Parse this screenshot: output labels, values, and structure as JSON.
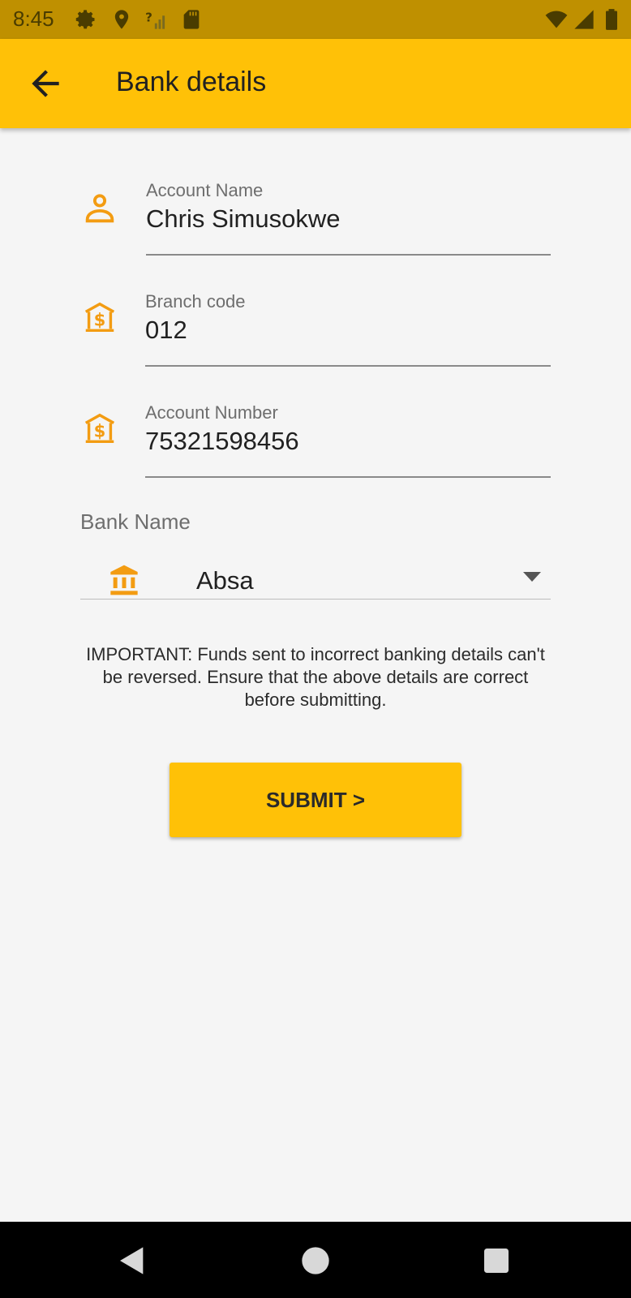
{
  "status_bar": {
    "time": "8:45",
    "icons_left": [
      "gear-icon",
      "location-pin-icon",
      "no-signal-icon",
      "sd-card-icon"
    ],
    "icons_right": [
      "wifi-icon",
      "signal-icon",
      "battery-icon"
    ]
  },
  "app_bar": {
    "title": "Bank details",
    "back_icon": "arrow-back-icon"
  },
  "form": {
    "account_name": {
      "label": "Account Name",
      "value": "Chris Simusokwe",
      "icon": "person-icon"
    },
    "branch_code": {
      "label": "Branch code",
      "value": "012",
      "icon": "bank-dollar-icon"
    },
    "account_number": {
      "label": "Account Number",
      "value": "75321598456",
      "icon": "bank-dollar-icon"
    },
    "bank_name": {
      "label": "Bank Name",
      "selected": "Absa",
      "icon": "bank-icon"
    }
  },
  "notice": "IMPORTANT: Funds sent to incorrect banking details can't be reversed. Ensure that the above details are correct before submitting.",
  "submit_label": "SUBMIT >",
  "colors": {
    "accent": "#ffc107",
    "status_bar": "#bf9000",
    "icon": "#f39c12"
  },
  "nav_bar": {
    "icons": [
      "back-triangle-icon",
      "home-circle-icon",
      "recents-square-icon"
    ]
  }
}
